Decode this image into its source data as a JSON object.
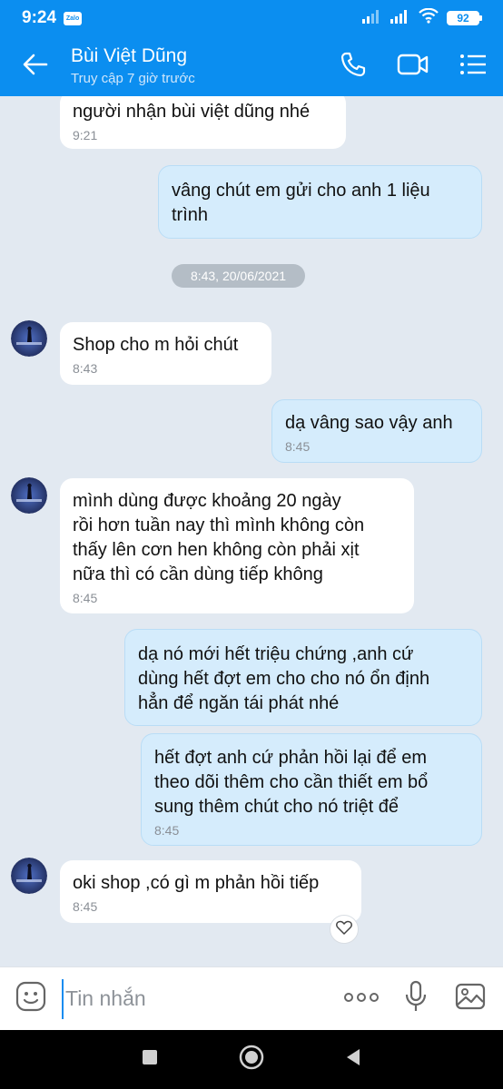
{
  "status_bar": {
    "time": "9:24",
    "app_badge": "Zalo",
    "battery": "92"
  },
  "header": {
    "contact_name": "Bùi Việt Dũng",
    "last_seen": "Truy cập 7 giờ trước",
    "icons": [
      "back-arrow-icon",
      "phone-icon",
      "video-call-icon",
      "menu-icon"
    ]
  },
  "chat": {
    "date_separator": "8:43, 20/06/2021",
    "messages": [
      {
        "direction": "in",
        "text": "người nhận bùi việt dũng nhé",
        "time": "9:21"
      },
      {
        "direction": "out",
        "text": "vâng chút em gửi cho anh  1 liệu\ntrình",
        "time": ""
      },
      {
        "direction": "in",
        "text": "Shop cho m hỏi chút",
        "time": "8:43"
      },
      {
        "direction": "out",
        "text": "dạ vâng sao vậy anh",
        "time": "8:45"
      },
      {
        "direction": "in",
        "text": "mình dùng được khoảng 20 ngày\nrồi hơn tuần nay thì mình không còn\nthấy lên cơn hen không còn phải xịt\nnữa thì có cần dùng tiếp không",
        "time": "8:45"
      },
      {
        "direction": "out",
        "text": "dạ nó mới hết triệu chứng ,anh cứ\ndùng hết đợt em cho cho nó ổn định\nhẳn để ngăn tái phát nhé",
        "time": ""
      },
      {
        "direction": "out",
        "text": "hết đợt anh cứ phản hồi lại để em\ntheo dõi thêm cho cần thiết em bổ\nsung thêm chút cho nó triệt để",
        "time": "8:45"
      },
      {
        "direction": "in",
        "text": "oki shop ,có gì m phản hồi tiếp",
        "time": "8:45"
      }
    ]
  },
  "input": {
    "placeholder": "Tin nhắn",
    "value": ""
  },
  "colors": {
    "brand_blue": "#0b8ef0",
    "chat_bg": "#e2e9f1",
    "outgoing_bubble": "#d5ecfc",
    "incoming_bubble": "#ffffff"
  }
}
